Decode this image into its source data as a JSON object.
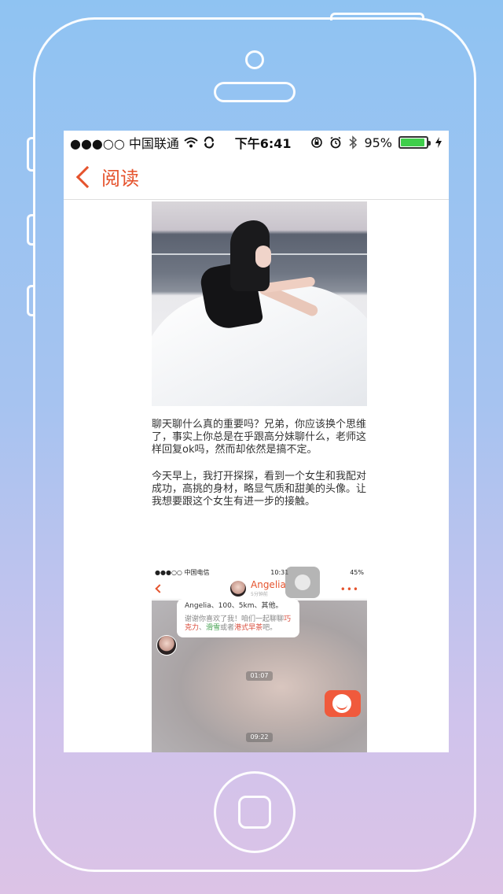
{
  "status_bar": {
    "carrier": "●●●○○ 中国联通",
    "time": "下午6:41",
    "battery_percent": "95%",
    "battery_level": 0.95
  },
  "nav": {
    "back_label": "阅读"
  },
  "article": {
    "paragraphs": [
      "聊天聊什么真的重要吗？兄弟，你应该换个思维了，事实上你总是在乎跟高分妹聊什么，老师这样回复ok吗，然而却依然是搞不定。",
      "今天早上，我打开探探，看到一个女生和我配对成功，高挑的身材，略显气质和甜美的头像。让我想要跟这个女生有进一步的接触。"
    ]
  },
  "chat_screenshot": {
    "status_left": "●●●○○ 中国电信",
    "status_time": "10:31",
    "status_battery": "45%",
    "contact_name": "Angelia",
    "contact_sub": "5分钟前",
    "bubble_line1": "Angelia、100、5km、其他。",
    "bubble_thanks_prefix": "谢谢你喜欢了我！咱们一起聊聊",
    "bubble_hl1": "巧克力",
    "bubble_sep1": "、",
    "bubble_hl2": "滑雪",
    "bubble_sep2": "或者",
    "bubble_hl3": "港式早茶",
    "bubble_suffix": "吧。",
    "time_chip_1": "01:07",
    "time_chip_2": "09:22"
  }
}
